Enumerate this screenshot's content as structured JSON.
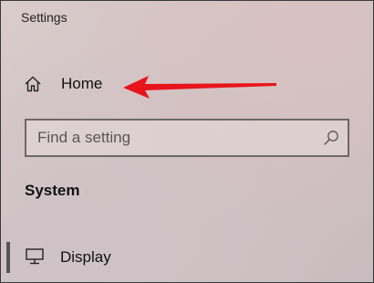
{
  "window": {
    "title": "Settings"
  },
  "nav": {
    "home": {
      "label": "Home",
      "icon": "home-icon"
    },
    "display": {
      "label": "Display",
      "icon": "monitor-icon"
    }
  },
  "search": {
    "placeholder": "Find a setting",
    "value": "",
    "icon": "search-icon"
  },
  "section": {
    "title": "System"
  },
  "annotation": {
    "arrow_color": "#e8141c"
  }
}
